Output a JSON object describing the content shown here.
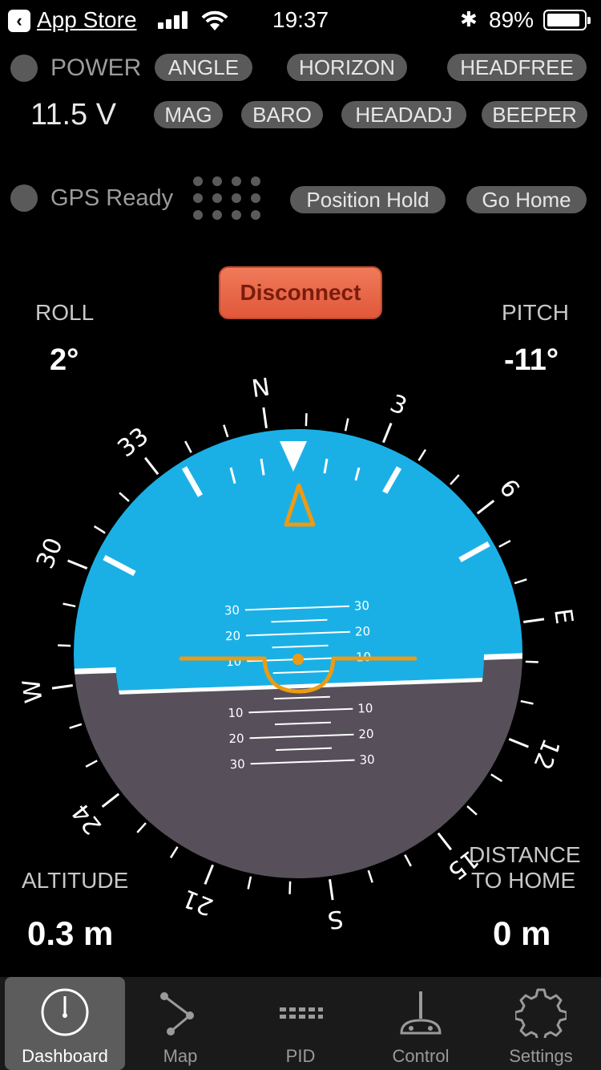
{
  "status_bar": {
    "back_app": "App Store",
    "time": "19:37",
    "battery": "89%",
    "battery_level": 0.89
  },
  "modes": {
    "power_label": "POWER",
    "voltage": "11.5 V",
    "gps_label": "GPS Ready",
    "buttons": [
      "ANGLE",
      "HORIZON",
      "HEADFREE",
      "MAG",
      "BARO",
      "HEADADJ",
      "BEEPER",
      "Position Hold",
      "Go Home"
    ]
  },
  "disconnect_label": "Disconnect",
  "telemetry": {
    "roll_label": "ROLL",
    "roll": "2°",
    "pitch_label": "PITCH",
    "pitch": "-11°",
    "altitude_label": "ALTITUDE",
    "altitude": "0.3 m",
    "distance_line1": "DISTANCE",
    "distance_line2": "TO HOME",
    "distance": "0 m"
  },
  "compass": {
    "labels": [
      "3",
      "6",
      "E",
      "12",
      "15",
      "S",
      "21",
      "24",
      "W",
      "30",
      "33",
      "N"
    ],
    "pitch_scale": [
      "10",
      "20",
      "30"
    ],
    "colors": {
      "sky": "#1ab0e6",
      "ground": "#57505a",
      "marker": "#ee9a12"
    }
  },
  "tabs": [
    {
      "label": "Dashboard",
      "icon": "dashboard-gauge-icon",
      "active": true
    },
    {
      "label": "Map",
      "icon": "map-waypoints-icon",
      "active": false
    },
    {
      "label": "PID",
      "icon": "pid-grid-icon",
      "active": false
    },
    {
      "label": "Control",
      "icon": "control-joystick-icon",
      "active": false
    },
    {
      "label": "Settings",
      "icon": "settings-gear-icon",
      "active": false
    }
  ]
}
